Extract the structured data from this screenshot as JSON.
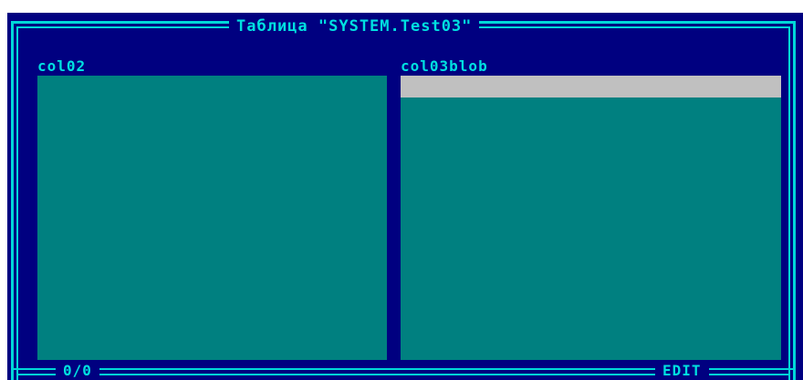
{
  "window": {
    "title": "Таблица \"SYSTEM.Test03\""
  },
  "columns": [
    {
      "label": "col02"
    },
    {
      "label": "col03blob"
    }
  ],
  "status": {
    "position": "0/0",
    "mode": "EDIT"
  },
  "colors": {
    "background": "#000080",
    "frame": "#00d8d8",
    "panel": "#008080",
    "selection": "#c0c0c0",
    "text": "#00e0e0"
  }
}
